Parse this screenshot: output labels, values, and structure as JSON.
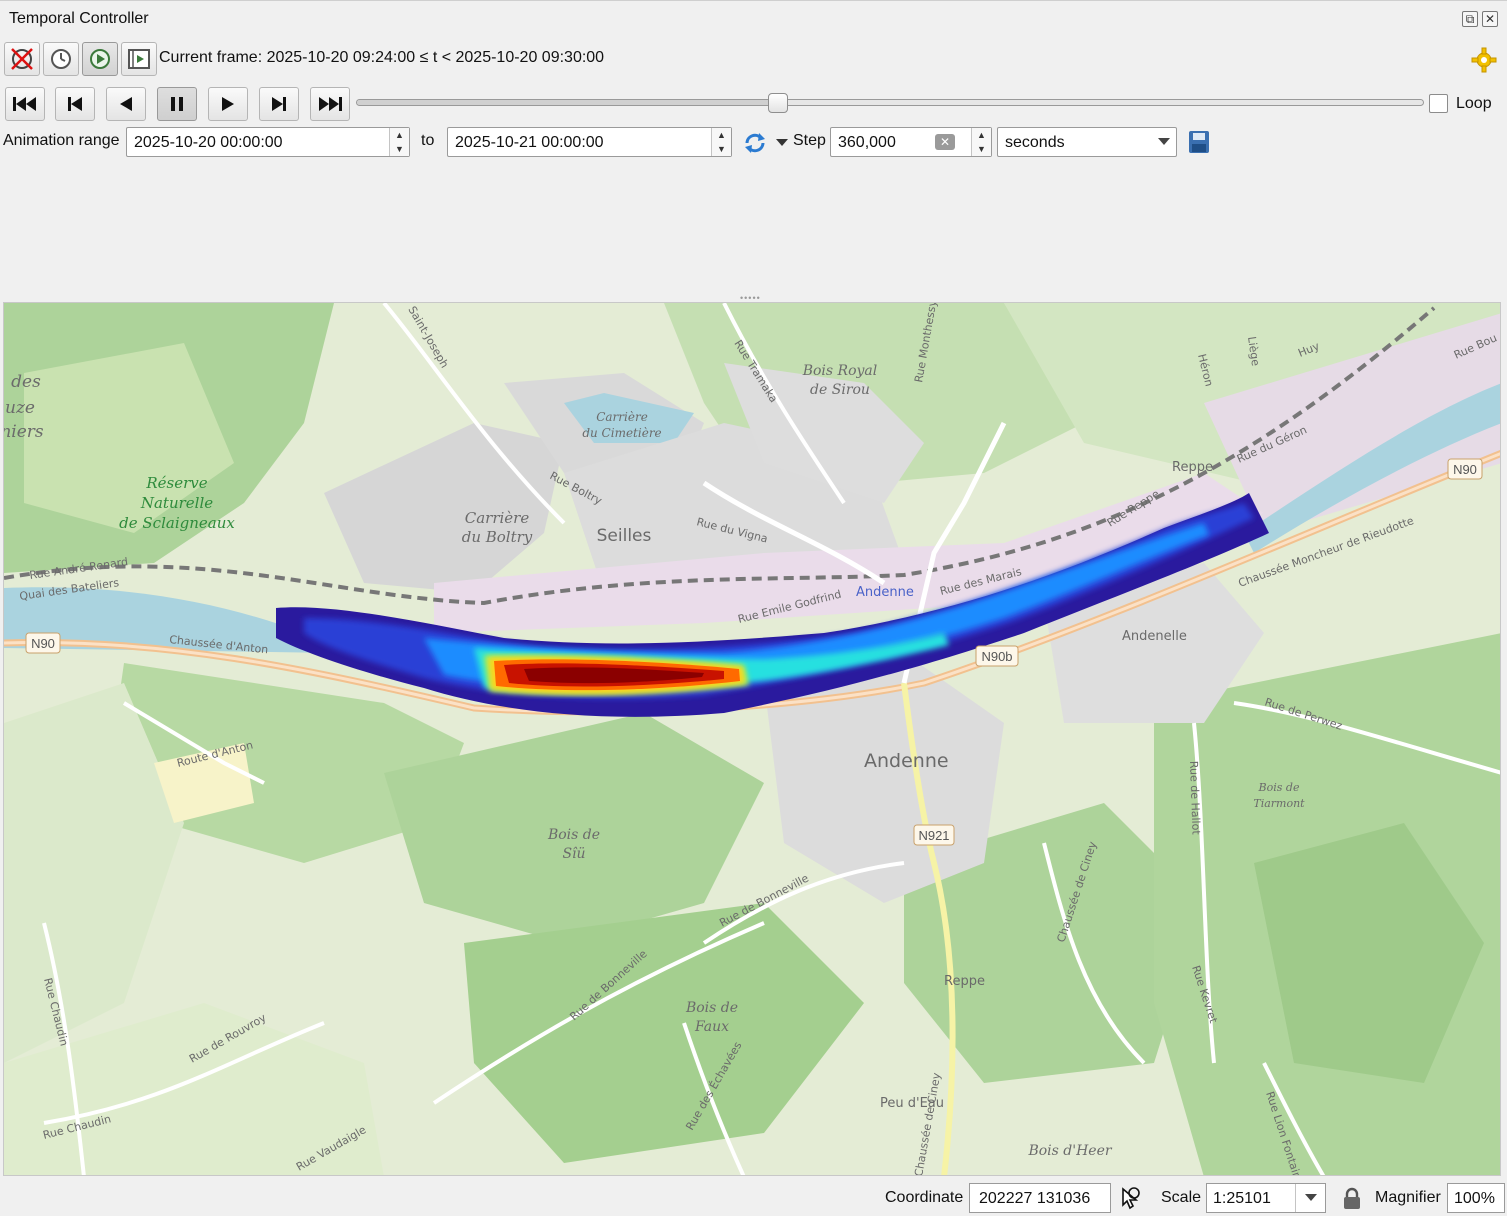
{
  "window": {
    "title": "Temporal Controller"
  },
  "toolbar": {
    "current_frame_label": "Current frame: 2025-10-20 09:24:00 ≤ t < 2025-10-20 09:30:00"
  },
  "playback": {
    "loop_label": "Loop",
    "loop_checked": false,
    "slider_fraction": 0.395
  },
  "range": {
    "label": "Animation range",
    "start": "2025-10-20 00:00:00",
    "to_label": "to",
    "end": "2025-10-21 00:00:00",
    "step_label": "Step",
    "step_value": "360,000",
    "step_unit": "seconds"
  },
  "map": {
    "labels": {
      "seilles": "Seilles",
      "andenne": "Andenne",
      "andenne_blue": "Andenne",
      "andenelle": "Andenelle",
      "reppe_n": "Reppe",
      "reppe_s": "Reppe",
      "peu_deau": "Peu d'Eau",
      "reserve1": "Réserve",
      "reserve2": "Naturelle",
      "reserve3": "de Sclaigneaux",
      "carriere_boltry1": "Carrière",
      "carriere_boltry2": "du Boltry",
      "carriere_cim1": "Carrière",
      "carriere_cim2": "du Cimetière",
      "bois_royal1": "Bois Royal",
      "bois_royal2": "de Sirou",
      "bois_siu1": "Bois de",
      "bois_siu2": "Sîü",
      "bois_faux1": "Bois de",
      "bois_faux2": "Faux",
      "bois_tiarmont1": "Bois de",
      "bois_tiarmont2": "Tiarmont",
      "bois_heer": "Bois d'Heer",
      "des1": "des",
      "des2": "uze",
      "des3": "niers",
      "rue_boltry": "Rue Boltry",
      "rue_vigna": "Rue du Vigna",
      "rue_godfrind": "Rue Emile Godfrind",
      "rue_marais": "Rue des Marais",
      "rue_reppe": "Rue Reppe",
      "rue_geron": "Rue du Géron",
      "rue_andre_renard": "Rue André Renard",
      "quai_bateliers": "Quai des Bateliers",
      "chaussee_anton": "Chaussée d'Anton",
      "route_anton": "Route d'Anton",
      "chaussee_moncheur": "Chaussée Moncheur de Rieudotte",
      "rue_perwez": "Rue de Perwez",
      "rue_bonneville": "Rue de Bonneville",
      "rue_bonneville2": "Rue de Bonneville",
      "chaussee_ciney": "Chaussée de Ciney",
      "rue_hallot": "Rue de Hallot",
      "rue_kevret": "Rue Kevret",
      "rue_chaudin": "Rue Chaudin",
      "rue_chaudin2": "Rue Chaudin",
      "rue_rouvroy": "Rue de Rouvroy",
      "rue_vaudaigle": "Rue Vaudaigle",
      "rue_echavees": "Rue des Échavées",
      "rue_tramaka": "Rue Tramaka",
      "rue_monthessy": "Rue Monthessy",
      "saint_joseph": "Saint-Joseph",
      "rue_heron": "Héron",
      "rue_liege": "Liège",
      "rue_huy": "Huy",
      "rue_bou": "Rue Bou",
      "rue_lion_fontaine": "Rue Lion Fontaine",
      "chaussee_ciney2": "Chaussée de Ciney",
      "n90_w": "N90",
      "n90_e": "N90",
      "n90b": "N90b",
      "n921": "N921"
    }
  },
  "statusbar": {
    "coordinate_label": "Coordinate",
    "coordinate_value": "202227  131036",
    "scale_label": "Scale",
    "scale_value": "1:25101",
    "magnifier_label": "Magnifier",
    "magnifier_value": "100%"
  },
  "colors": {
    "river": "#aad3df",
    "forest": "#a8d192",
    "urban": "#dddddd",
    "heat_low": "#2a1a9e",
    "heat_high": "#8b0000"
  }
}
